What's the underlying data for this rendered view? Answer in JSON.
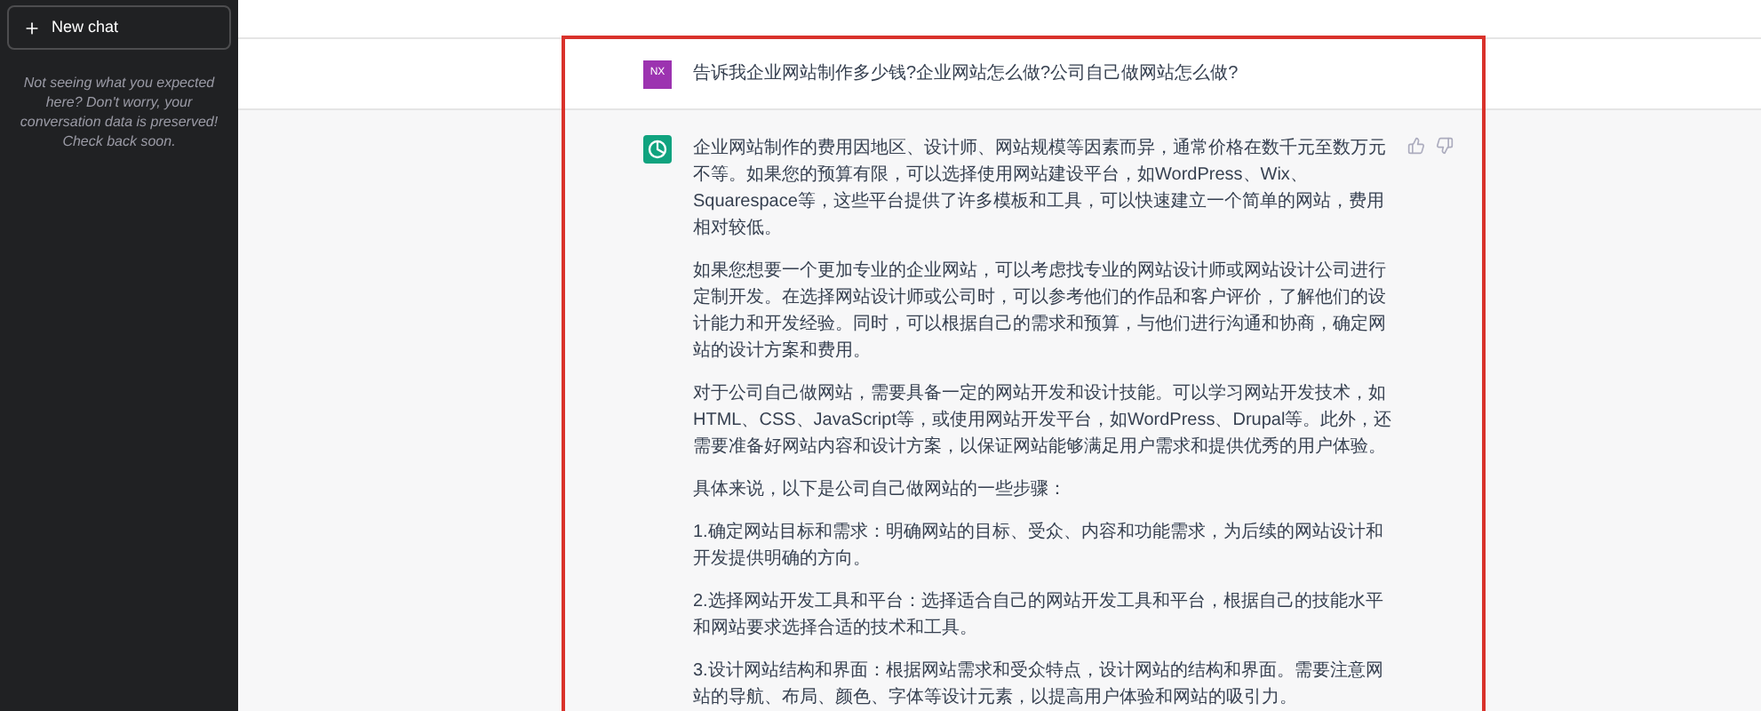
{
  "sidebar": {
    "new_chat_button": {
      "label": "New chat"
    },
    "notice": "Not seeing what you expected here? Don't worry, your conversation data is preserved! Check back soon."
  },
  "conversation": {
    "user_message": {
      "avatar": "NX",
      "text": "告诉我企业网站制作多少钱?企业网站怎么做?公司自己做网站怎么做?"
    },
    "assistant_message": {
      "paragraphs": [
        "企业网站制作的费用因地区、设计师、网站规模等因素而异，通常价格在数千元至数万元不等。如果您的预算有限，可以选择使用网站建设平台，如WordPress、Wix、Squarespace等，这些平台提供了许多模板和工具，可以快速建立一个简单的网站，费用相对较低。",
        "如果您想要一个更加专业的企业网站，可以考虑找专业的网站设计师或网站设计公司进行定制开发。在选择网站设计师或公司时，可以参考他们的作品和客户评价，了解他们的设计能力和开发经验。同时，可以根据自己的需求和预算，与他们进行沟通和协商，确定网站的设计方案和费用。",
        "对于公司自己做网站，需要具备一定的网站开发和设计技能。可以学习网站开发技术，如HTML、CSS、JavaScript等，或使用网站开发平台，如WordPress、Drupal等。此外，还需要准备好网站内容和设计方案，以保证网站能够满足用户需求和提供优秀的用户体验。",
        "具体来说，以下是公司自己做网站的一些步骤：",
        "1.确定网站目标和需求：明确网站的目标、受众、内容和功能需求，为后续的网站设计和开发提供明确的方向。",
        "2.选择网站开发工具和平台：选择适合自己的网站开发工具和平台，根据自己的技能水平和网站要求选择合适的技术和工具。",
        "3.设计网站结构和界面：根据网站需求和受众特点，设计网站的结构和界面。需要注意网站的导航、布局、颜色、字体等设计元素，以提高用户体验和网站的吸引力。"
      ]
    }
  }
}
